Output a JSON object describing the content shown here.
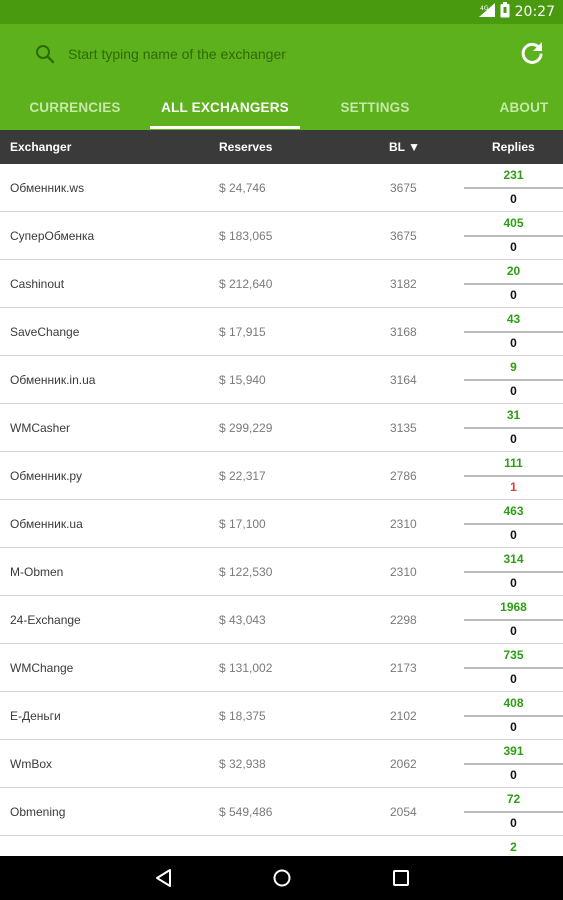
{
  "status_bar": {
    "time": "20:27",
    "network": "4G"
  },
  "search": {
    "placeholder": "Start typing name of the exchanger"
  },
  "tabs": [
    {
      "label": "CURRENCIES"
    },
    {
      "label": "ALL EXCHANGERS"
    },
    {
      "label": "SETTINGS"
    },
    {
      "label": "ABOUT"
    }
  ],
  "active_tab": "ALL EXCHANGERS",
  "table": {
    "headers": {
      "exchanger": "Exchanger",
      "reserves": "Reserves",
      "bl": "BL ▼",
      "replies": "Replies"
    },
    "rows": [
      {
        "name": "Обменник.ws",
        "reserves": "$ 24,746",
        "bl": "3675",
        "pos": "231",
        "neg": "0"
      },
      {
        "name": "СуперОбменка",
        "reserves": "$ 183,065",
        "bl": "3675",
        "pos": "405",
        "neg": "0"
      },
      {
        "name": "Cashinout",
        "reserves": "$ 212,640",
        "bl": "3182",
        "pos": "20",
        "neg": "0"
      },
      {
        "name": "SaveChange",
        "reserves": "$ 17,915",
        "bl": "3168",
        "pos": "43",
        "neg": "0"
      },
      {
        "name": "Обменник.in.ua",
        "reserves": "$ 15,940",
        "bl": "3164",
        "pos": "9",
        "neg": "0"
      },
      {
        "name": "WMCasher",
        "reserves": "$ 299,229",
        "bl": "3135",
        "pos": "31",
        "neg": "0"
      },
      {
        "name": "Обменник.ру",
        "reserves": "$ 22,317",
        "bl": "2786",
        "pos": "111",
        "neg": "1"
      },
      {
        "name": "Обменник.ua",
        "reserves": "$ 17,100",
        "bl": "2310",
        "pos": "463",
        "neg": "0"
      },
      {
        "name": "M-Obmen",
        "reserves": "$ 122,530",
        "bl": "2310",
        "pos": "314",
        "neg": "0"
      },
      {
        "name": "24-Exchange",
        "reserves": "$ 43,043",
        "bl": "2298",
        "pos": "1968",
        "neg": "0"
      },
      {
        "name": "WMChange",
        "reserves": "$ 131,002",
        "bl": "2173",
        "pos": "735",
        "neg": "0"
      },
      {
        "name": "E-Деньги",
        "reserves": "$ 18,375",
        "bl": "2102",
        "pos": "408",
        "neg": "0"
      },
      {
        "name": "WmBox",
        "reserves": "$ 32,938",
        "bl": "2062",
        "pos": "391",
        "neg": "0"
      },
      {
        "name": "Obmening",
        "reserves": "$ 549,486",
        "bl": "2054",
        "pos": "72",
        "neg": "0"
      },
      {
        "name": "",
        "reserves": "",
        "bl": "",
        "pos": "2",
        "neg": ""
      }
    ]
  },
  "colors": {
    "status_bar": "#4a9a10",
    "app_bar": "#5cb11c",
    "table_header": "#3a3a3a",
    "positive": "#2e9e14",
    "negative_highlight": "#e53935"
  },
  "icons": [
    "search-icon",
    "refresh-icon",
    "back-icon",
    "home-icon",
    "recents-icon"
  ]
}
